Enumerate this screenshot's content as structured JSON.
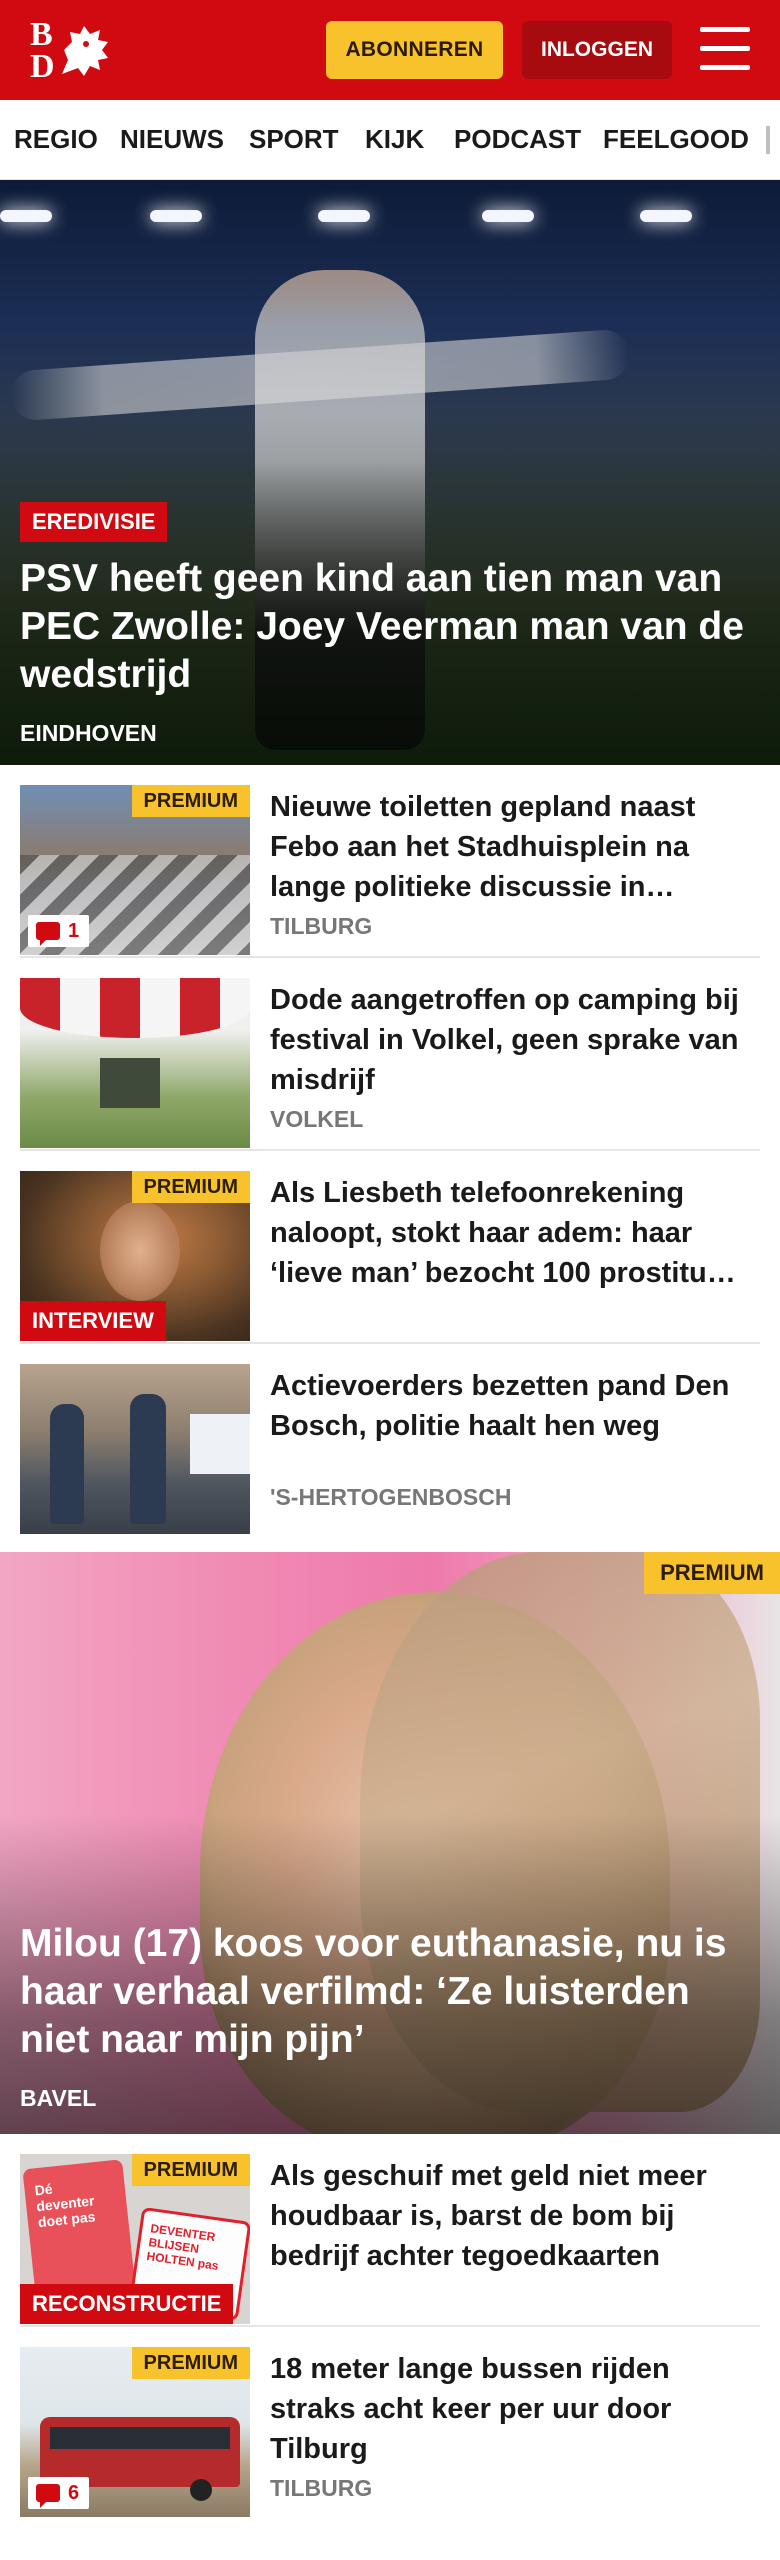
{
  "header": {
    "logo_text_top": "B",
    "logo_text_bottom": "D",
    "subscribe_label": "ABONNEREN",
    "login_label": "INLOGGEN",
    "brand_color": "#d10a11"
  },
  "nav": {
    "items": [
      "REGIO",
      "NIEUWS",
      "SPORT",
      "KIJK",
      "PODCAST",
      "FEELGOOD"
    ]
  },
  "hero": {
    "category": "EREDIVISIE",
    "title": "PSV heeft geen kind aan tien man van PEC Zwolle: Joey Veerman man van de wedstrijd",
    "location": "EINDHOVEN"
  },
  "articles": [
    {
      "premium": "PREMIUM",
      "title": "Nieuwe toiletten gepland naast Febo aan het Stadhuisplein na lange politieke discussie in…",
      "location": "TILBURG",
      "comments": "1"
    },
    {
      "title": "Dode aangetroffen op camping bij festival in Volkel, geen sprake van misdrijf",
      "location": "VOLKEL"
    },
    {
      "premium": "PREMIUM",
      "label": "INTERVIEW",
      "title": "Als Liesbeth telefoonrekening naloopt, stokt haar adem: haar ‘lieve man’ bezocht 100 prostitu…"
    },
    {
      "title": "Actievoerders bezetten pand Den Bosch, politie haalt hen weg",
      "location": "'S-HERTOGENBOSCH"
    }
  ],
  "feature": {
    "premium": "PREMIUM",
    "title": "Milou (17) koos voor euthanasie, nu is haar verhaal verfilmd: ‘Ze luisterden niet naar mijn pijn’",
    "location": "BAVEL"
  },
  "articles2": [
    {
      "premium": "PREMIUM",
      "label": "RECONSTRUCTIE",
      "title": "Als geschuif met geld niet meer houdbaar is, barst de bom bij bedrijf achter tegoedkaarten",
      "thumb_text_1": "Dé deventer doet pas",
      "thumb_text_2": "DEVENTER BLIJSEN HOLTEN pas"
    },
    {
      "premium": "PREMIUM",
      "title": "18 meter lange bussen rijden straks acht keer per uur door Tilburg",
      "location": "TILBURG",
      "comments": "6"
    }
  ]
}
